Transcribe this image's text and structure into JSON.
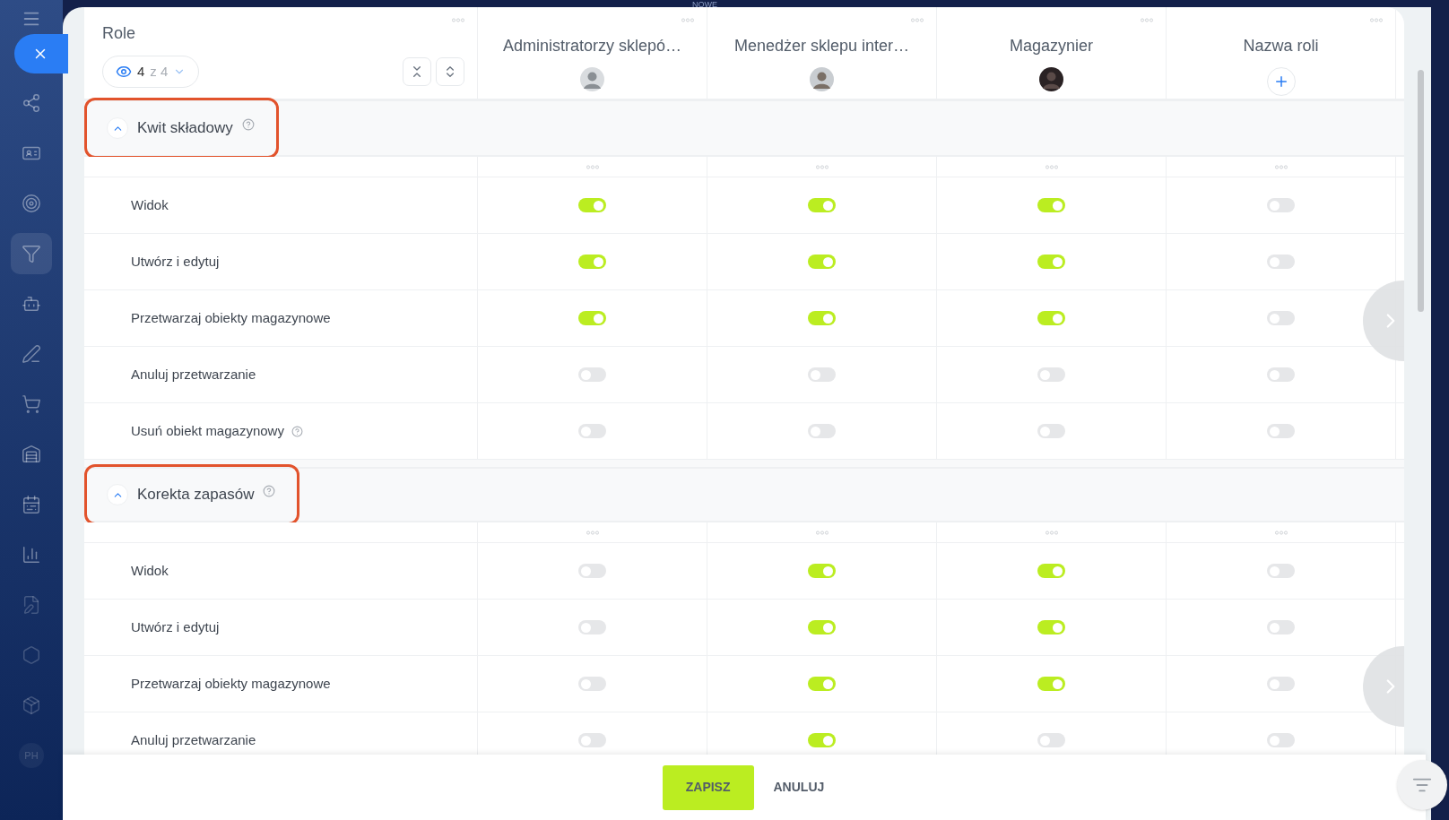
{
  "top_badge": "NOWE",
  "sidebar": {
    "items": [
      {
        "kind": "icon",
        "selected": false
      },
      {
        "kind": "icon",
        "selected": false
      },
      {
        "kind": "icon",
        "selected": false
      },
      {
        "kind": "icon",
        "selected": true
      },
      {
        "kind": "icon",
        "selected": false
      },
      {
        "kind": "icon",
        "selected": false
      },
      {
        "kind": "icon",
        "selected": false
      },
      {
        "kind": "icon",
        "selected": false
      },
      {
        "kind": "icon",
        "selected": false
      },
      {
        "kind": "icon",
        "selected": false
      },
      {
        "kind": "icon",
        "selected": false
      },
      {
        "kind": "icon",
        "selected": false
      },
      {
        "kind": "icon",
        "selected": false
      },
      {
        "kind": "text",
        "label": "PH",
        "selected": false
      }
    ]
  },
  "header": {
    "title": "Role",
    "count_shown": "4",
    "count_total": "z 4"
  },
  "roles": [
    {
      "name": "Administratorzy sklepó…",
      "kind": "avatar"
    },
    {
      "name": "Menedżer sklepu inter…",
      "kind": "avatar"
    },
    {
      "name": "Magazynier",
      "kind": "avatar"
    },
    {
      "name": "Nazwa roli",
      "kind": "add"
    }
  ],
  "sections": [
    {
      "title": "Kwit składowy",
      "expanded": true,
      "help": true,
      "highlighted": true,
      "permissions": [
        {
          "label": "Widok",
          "help": false,
          "values": [
            true,
            true,
            true,
            false
          ]
        },
        {
          "label": "Utwórz i edytuj",
          "help": false,
          "values": [
            true,
            true,
            true,
            false
          ]
        },
        {
          "label": "Przetwarzaj obiekty magazynowe",
          "help": false,
          "values": [
            true,
            true,
            true,
            false
          ]
        },
        {
          "label": "Anuluj przetwarzanie",
          "help": false,
          "values": [
            false,
            false,
            false,
            false
          ]
        },
        {
          "label": "Usuń obiekt magazynowy",
          "help": true,
          "values": [
            false,
            false,
            false,
            false
          ]
        }
      ]
    },
    {
      "title": "Korekta zapasów",
      "expanded": true,
      "help": true,
      "highlighted": true,
      "permissions": [
        {
          "label": "Widok",
          "help": false,
          "values": [
            false,
            true,
            true,
            false
          ]
        },
        {
          "label": "Utwórz i edytuj",
          "help": false,
          "values": [
            false,
            true,
            true,
            false
          ]
        },
        {
          "label": "Przetwarzaj obiekty magazynowe",
          "help": false,
          "values": [
            false,
            true,
            true,
            false
          ]
        },
        {
          "label": "Anuluj przetwarzanie",
          "help": false,
          "values": [
            false,
            true,
            false,
            false
          ]
        }
      ]
    }
  ],
  "footer": {
    "buttons": [
      {
        "label": "ZAPISZ",
        "kind": "primary"
      },
      {
        "label": "ANULUJ",
        "kind": "secondary"
      }
    ]
  }
}
